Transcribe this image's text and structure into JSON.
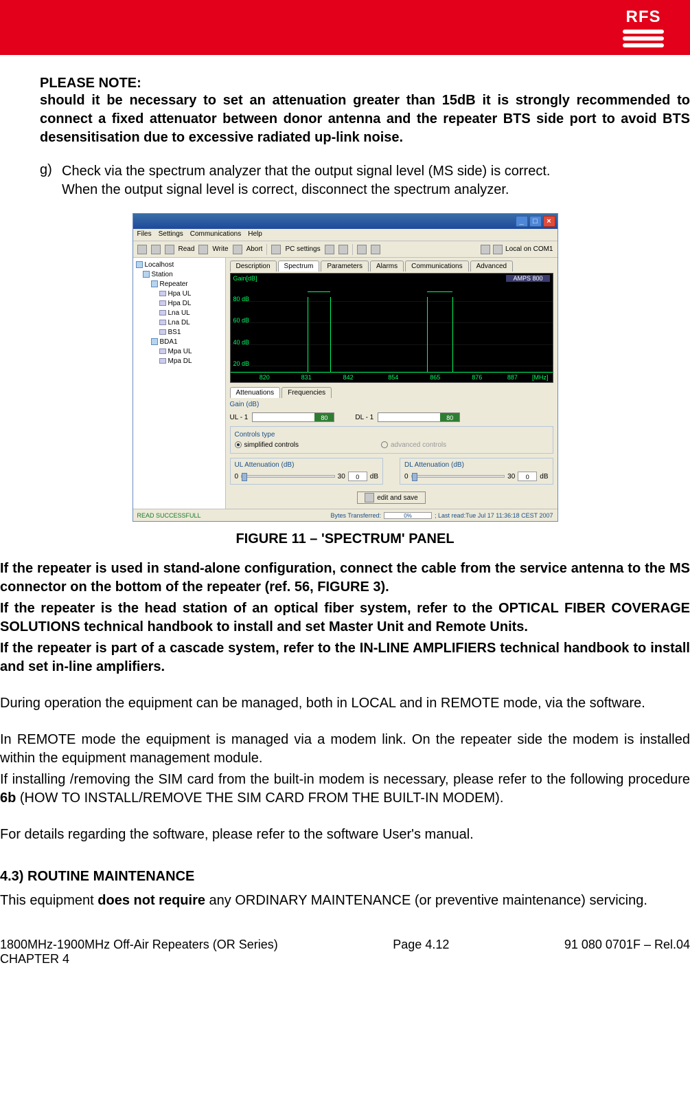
{
  "header": {
    "logo_text": "RFS"
  },
  "note": {
    "title": "PLEASE NOTE:",
    "body": "should it be necessary to set an attenuation greater than 15dB it is strongly recommended to connect a fixed attenuator between donor antenna and the repeater BTS side port to avoid BTS desensitisation due to excessive radiated up-link noise."
  },
  "list_g": {
    "marker": "g)",
    "line1": "Check via the spectrum analyzer that the output signal level (MS side) is correct.",
    "line2": "When the output signal level is correct, disconnect the spectrum analyzer."
  },
  "window": {
    "menus": [
      "Files",
      "Settings",
      "Communications",
      "Help"
    ],
    "toolbar": {
      "read": "Read",
      "write": "Write",
      "abort": "Abort",
      "pc_settings": "PC settings",
      "conn_label": "Local on COM1"
    },
    "tree": {
      "root": "Localhost",
      "station": "Station",
      "repeater": "Repeater",
      "repeater_children": [
        "Hpa UL",
        "Hpa DL",
        "Lna UL",
        "Lna DL",
        "BS1"
      ],
      "bda": "BDA1",
      "bda_children": [
        "Mpa UL",
        "Mpa DL"
      ]
    },
    "tabs": [
      "Description",
      "Spectrum",
      "Parameters",
      "Alarms",
      "Communications",
      "Advanced"
    ],
    "tabs_active": "Spectrum",
    "spectrum": {
      "ylabel": "Gain[dB]",
      "band": "AMPS 800",
      "y_ticks": [
        "80 dB",
        "60 dB",
        "40 dB",
        "20 dB"
      ],
      "x_ticks": [
        "820",
        "831",
        "842",
        "854",
        "865",
        "876",
        "887"
      ],
      "x_unit": "[MHz]"
    },
    "subtabs": [
      "Attenuations",
      "Frequencies"
    ],
    "gain_section": {
      "title": "Gain (dB)",
      "ul_label": "UL - 1",
      "ul_val": "80",
      "dl_label": "DL - 1",
      "dl_val": "80"
    },
    "controls_type": {
      "title": "Controls type",
      "opt1": "simplified controls",
      "opt2": "advanced controls"
    },
    "attenuation": {
      "ul_title": "UL Attenuation (dB)",
      "dl_title": "DL Attenuation (dB)",
      "min": "0",
      "max": "30",
      "val": "0",
      "unit": "dB"
    },
    "edit_save": "edit and save",
    "status": {
      "left": "READ SUCCESSFULL",
      "bytes_label": "Bytes Transferred:",
      "bytes_val": "0%",
      "last_read": "; Last read:Tue Jul 17 11:36:18 CEST 2007"
    }
  },
  "figure_caption": "FIGURE 11 – 'SPECTRUM' PANEL",
  "paragraphs": {
    "p1": "If the repeater is used in stand-alone configuration, connect the cable from the service antenna to the MS connector on the bottom of the repeater (ref. 56, FIGURE 3).",
    "p2": "If the repeater is the head station of an optical fiber system, refer to the OPTICAL FIBER COVERAGE SOLUTIONS technical handbook to install and set Master Unit and Remote Units.",
    "p3": "If the repeater is part of a cascade system, refer to the IN-LINE AMPLIFIERS technical handbook to install and set in-line amplifiers.",
    "p4": "During operation the equipment can be managed, both in LOCAL and in REMOTE mode, via the software.",
    "p5": "In REMOTE mode the equipment is managed via a modem link. On the repeater side the  modem is installed within the equipment management module.",
    "p6_prefix": "If installing /removing the SIM card from the built-in modem is necessary, please refer to the following procedure ",
    "p6_bold": "6b",
    "p6_suffix": " (HOW TO INSTALL/REMOVE THE SIM CARD FROM THE BUILT-IN MODEM).",
    "p7": "For details regarding the software, please refer to the software User's manual."
  },
  "section_43": {
    "heading": "4.3) ROUTINE MAINTENANCE",
    "body_prefix": "This equipment ",
    "body_bold": "does not require",
    "body_suffix": " any ORDINARY MAINTENANCE (or preventive maintenance) servicing."
  },
  "footer": {
    "left_line1": "1800MHz-1900MHz Off-Air Repeaters (OR Series)",
    "left_line2": "CHAPTER 4",
    "center_prefix": "Page ",
    "center_num": "4.12",
    "right": "91 080 0701F – Rel.04"
  },
  "chart_data": {
    "type": "line",
    "title": "Gain[dB]",
    "xlabel": "[MHz]",
    "ylabel": "Gain[dB]",
    "ylim": [
      0,
      90
    ],
    "xlim": [
      820,
      890
    ],
    "x_ticks": [
      820,
      831,
      842,
      854,
      865,
      876,
      887
    ],
    "y_ticks": [
      20,
      40,
      60,
      80
    ],
    "series": [
      {
        "name": "Gain",
        "x": [
          820,
          833,
          833,
          838,
          838,
          860,
          860,
          866,
          866,
          890
        ],
        "values": [
          2,
          2,
          80,
          80,
          2,
          2,
          80,
          80,
          2,
          2
        ]
      }
    ]
  }
}
